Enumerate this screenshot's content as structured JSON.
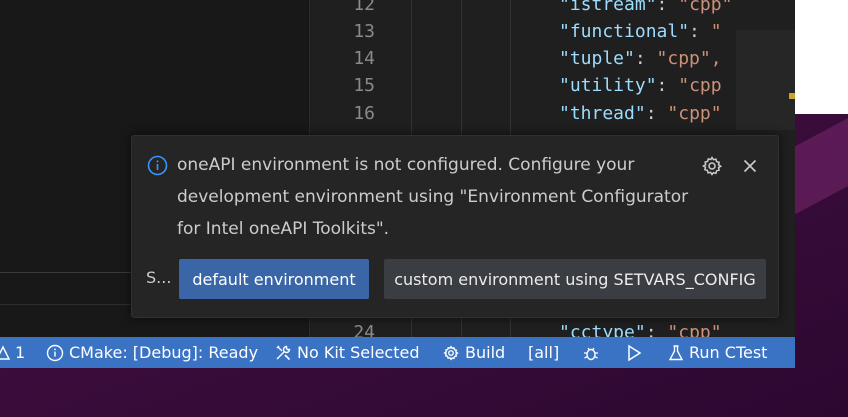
{
  "editor": {
    "lines": [
      {
        "num": "12",
        "key": "\"istream\"",
        "value": "\"cpp\""
      },
      {
        "num": "13",
        "key": "\"functional\"",
        "value": "\""
      },
      {
        "num": "14",
        "key": "\"tuple\"",
        "value": "\"cpp\","
      },
      {
        "num": "15",
        "key": "\"utility\"",
        "value": "\"cpp"
      },
      {
        "num": "16",
        "key": "\"thread\"",
        "value": "\"cpp\""
      },
      {
        "num": "24",
        "key": "\"cctype\"",
        "value": "\"cpp\""
      }
    ]
  },
  "notification": {
    "icon": "info-icon",
    "message_line1": "oneAPI environment is not configured. Configure your",
    "message_line2": "development environment using \"Environment Configurator",
    "message_line3": "for Intel oneAPI Toolkits\".",
    "source": "S...",
    "primary_button": "default environment",
    "secondary_button": "custom environment using SETVARS_CONFIG",
    "settings_icon": "gear-icon",
    "close_icon": "close-icon"
  },
  "statusbar": {
    "warnings": "1",
    "cmake_status": "CMake: [Debug]: Ready",
    "kit": "No Kit Selected",
    "build": "Build",
    "target": "[all]",
    "run_ctest": "Run CTest"
  },
  "colors": {
    "statusbar_bg": "#3a72c4",
    "primary_button_bg": "#3a66a8",
    "secondary_button_bg": "#3a3d41",
    "toast_bg": "#252526"
  }
}
